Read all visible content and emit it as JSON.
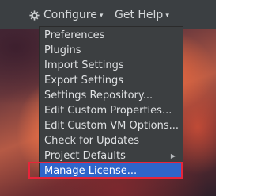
{
  "toolbar": {
    "configure": {
      "label": "Configure",
      "icon": "gear-icon",
      "caret": "▾"
    },
    "get_help": {
      "label": "Get Help",
      "caret": "▾"
    }
  },
  "menu": {
    "items": [
      {
        "label": "Preferences"
      },
      {
        "label": "Plugins"
      },
      {
        "label": "Import Settings"
      },
      {
        "label": "Export Settings"
      },
      {
        "label": "Settings Repository..."
      },
      {
        "label": "Edit Custom Properties..."
      },
      {
        "label": "Edit Custom VM Options..."
      },
      {
        "label": "Check for Updates"
      },
      {
        "label": "Project Defaults",
        "submenu_arrow": "▶"
      },
      {
        "label": "Manage License...",
        "selected": true
      }
    ]
  },
  "colors": {
    "menu_background": "#3c3f41",
    "selection": "#2f65ca",
    "highlight_outline": "#e8243a",
    "toolbar_background": "#3b3f42"
  }
}
